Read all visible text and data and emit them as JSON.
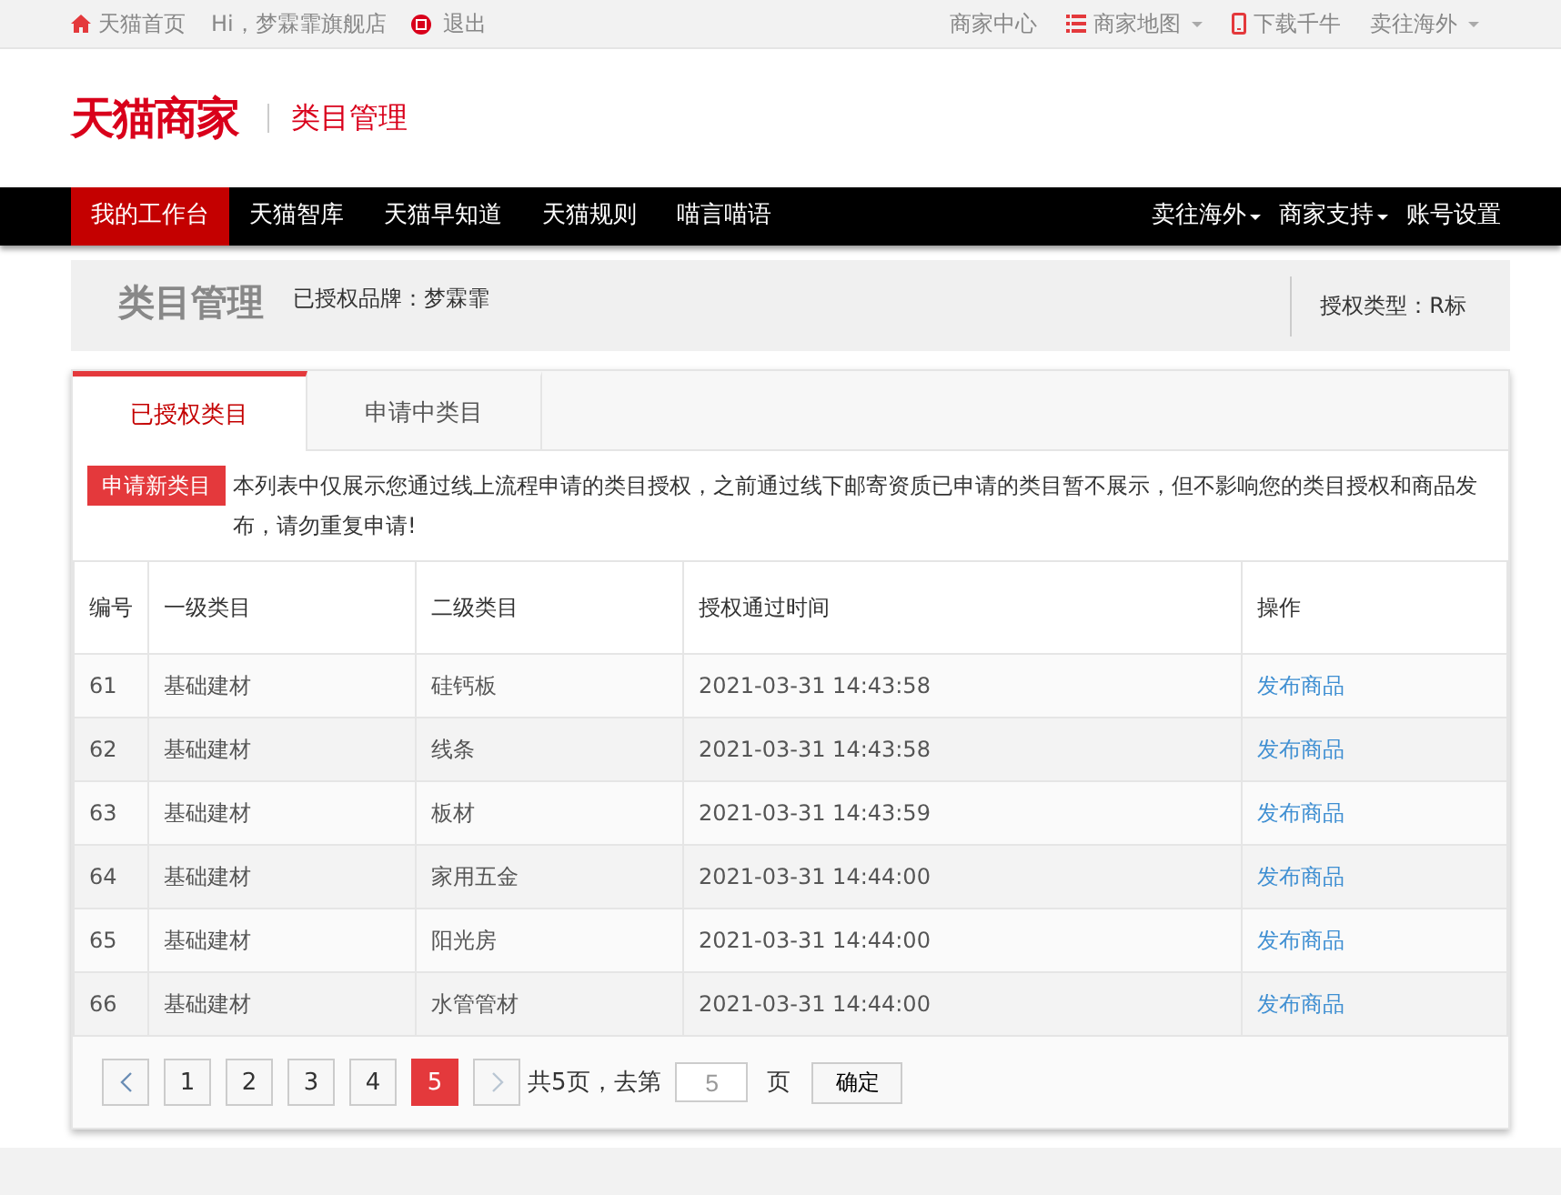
{
  "topbar": {
    "left": [
      {
        "kind": "home",
        "label": "天猫首页"
      },
      {
        "kind": "greeting",
        "label": "Hi，梦霖霏旗舰店"
      },
      {
        "kind": "logout",
        "label": "退出"
      }
    ],
    "right": [
      {
        "kind": "plain",
        "label": "商家中心"
      },
      {
        "kind": "sitemap",
        "label": "商家地图"
      },
      {
        "kind": "phone",
        "label": "下载千牛"
      },
      {
        "kind": "dropdown",
        "label": "卖往海外"
      }
    ]
  },
  "header": {
    "logo": "天猫商家",
    "subtitle": "类目管理"
  },
  "nav": {
    "left": [
      {
        "label": "我的工作台",
        "selected": true
      },
      {
        "label": "天猫智库",
        "selected": false
      },
      {
        "label": "天猫早知道",
        "selected": false
      },
      {
        "label": "天猫规则",
        "selected": false
      },
      {
        "label": "喵言喵语",
        "selected": false
      }
    ],
    "right": [
      {
        "label": "卖往海外",
        "dropdown": true
      },
      {
        "label": "商家支持",
        "dropdown": true
      },
      {
        "label": "账号设置",
        "dropdown": false
      }
    ]
  },
  "page_header": {
    "title": "类目管理",
    "brand": "已授权品牌：梦霖霏",
    "auth_type": "授权类型：R标"
  },
  "tabs": [
    {
      "label": "已授权类目",
      "selected": true
    },
    {
      "label": "申请中类目",
      "selected": false
    }
  ],
  "notice": {
    "button": "申请新类目",
    "text": "本列表中仅展示您通过线上流程申请的类目授权，之前通过线下邮寄资质已申请的类目暂不展示，但不影响您的类目授权和商品发布，请勿重复申请!"
  },
  "table": {
    "columns": [
      "编号",
      "一级类目",
      "二级类目",
      "授权通过时间",
      "操作"
    ],
    "rows": [
      {
        "id": "61",
        "cat1": "基础建材",
        "cat2": "硅钙板",
        "time": "2021-03-31 14:43:58",
        "action": "发布商品"
      },
      {
        "id": "62",
        "cat1": "基础建材",
        "cat2": "线条",
        "time": "2021-03-31 14:43:58",
        "action": "发布商品"
      },
      {
        "id": "63",
        "cat1": "基础建材",
        "cat2": "板材",
        "time": "2021-03-31 14:43:59",
        "action": "发布商品"
      },
      {
        "id": "64",
        "cat1": "基础建材",
        "cat2": "家用五金",
        "time": "2021-03-31 14:44:00",
        "action": "发布商品"
      },
      {
        "id": "65",
        "cat1": "基础建材",
        "cat2": "阳光房",
        "time": "2021-03-31 14:44:00",
        "action": "发布商品"
      },
      {
        "id": "66",
        "cat1": "基础建材",
        "cat2": "水管管材",
        "time": "2021-03-31 14:44:00",
        "action": "发布商品"
      }
    ]
  },
  "pagination": {
    "pages": [
      {
        "label": "1",
        "selected": false
      },
      {
        "label": "2",
        "selected": false
      },
      {
        "label": "3",
        "selected": false
      },
      {
        "label": "4",
        "selected": false
      },
      {
        "label": "5",
        "selected": true
      }
    ],
    "total": "共5页，去第",
    "goto_value": "5",
    "unit": "页",
    "confirm": "确定"
  }
}
